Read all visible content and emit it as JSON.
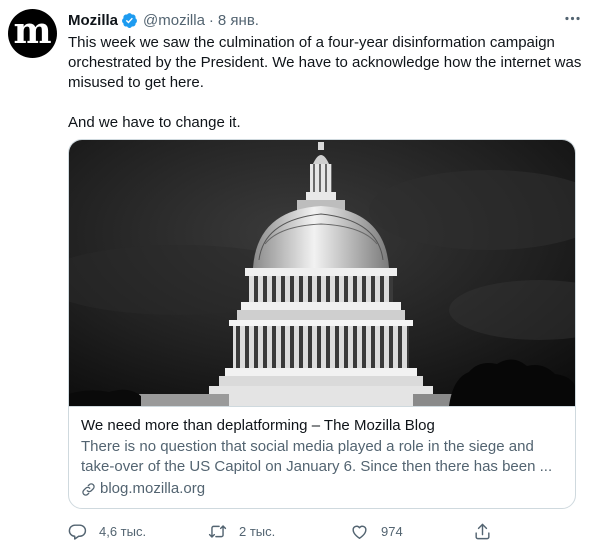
{
  "author": {
    "avatar_letter": "m",
    "name": "Mozilla",
    "handle": "@mozilla",
    "separator": "·",
    "date": "8 янв."
  },
  "tweet": {
    "paragraph1": "This week we saw the culmination of a four-year disinformation campaign orchestrated by the President. We have to acknowledge how the internet was misused to get here.",
    "paragraph2": "And we have to change it."
  },
  "card": {
    "title": "We need more than deplatforming – The Mozilla Blog",
    "description": "There is no question that social media played a role in the siege and take-over of the US Capitol on January 6. Since then there has been ...",
    "domain": "blog.mozilla.org"
  },
  "actions": {
    "replies": "4,6 тыс.",
    "retweets": "2 тыс.",
    "likes": "974"
  },
  "colors": {
    "accent": "#1d9bf0",
    "secondary_text": "#536471",
    "border": "#cfd9de"
  },
  "icons": [
    "verified-badge-icon",
    "more-icon",
    "link-icon",
    "reply-icon",
    "retweet-icon",
    "like-icon",
    "share-icon"
  ]
}
